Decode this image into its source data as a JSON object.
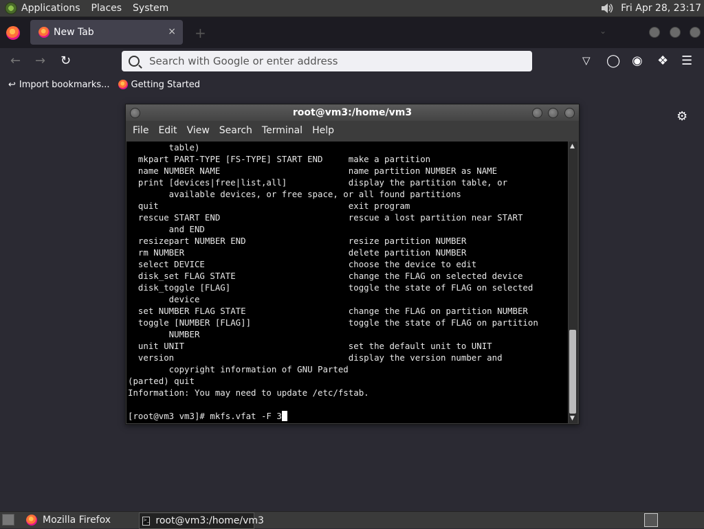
{
  "system_panel": {
    "menus": [
      "Applications",
      "Places",
      "System"
    ],
    "clock": "Fri Apr 28, 23:17"
  },
  "browser": {
    "tab": {
      "title": "New Tab",
      "close": "×"
    },
    "newtab_symbol": "+",
    "urlbar": {
      "placeholder": "Search with Google or enter address",
      "value": ""
    },
    "bookmarks": [
      {
        "label": "Import bookmarks...",
        "icon": "import-icon"
      },
      {
        "label": "Getting Started",
        "icon": "firefox-icon"
      }
    ]
  },
  "terminal": {
    "title": "root@vm3:/home/vm3",
    "menus": [
      "File",
      "Edit",
      "View",
      "Search",
      "Terminal",
      "Help"
    ],
    "lines": [
      "        table)",
      "  mkpart PART-TYPE [FS-TYPE] START END     make a partition",
      "  name NUMBER NAME                         name partition NUMBER as NAME",
      "  print [devices|free|list,all]            display the partition table, or",
      "        available devices, or free space, or all found partitions",
      "  quit                                     exit program",
      "  rescue START END                         rescue a lost partition near START",
      "        and END",
      "  resizepart NUMBER END                    resize partition NUMBER",
      "  rm NUMBER                                delete partition NUMBER",
      "  select DEVICE                            choose the device to edit",
      "  disk_set FLAG STATE                      change the FLAG on selected device",
      "  disk_toggle [FLAG]                       toggle the state of FLAG on selected",
      "        device",
      "  set NUMBER FLAG STATE                    change the FLAG on partition NUMBER",
      "  toggle [NUMBER [FLAG]]                   toggle the state of FLAG on partition",
      "        NUMBER",
      "  unit UNIT                                set the default unit to UNIT",
      "  version                                  display the version number and",
      "        copyright information of GNU Parted",
      "(parted) quit",
      "Information: You may need to update /etc/fstab.",
      "",
      "[root@vm3 vm3]# mkfs.vfat -F 3"
    ]
  },
  "taskbar": {
    "tasks": [
      {
        "label": "Mozilla Firefox",
        "icon": "firefox-icon"
      },
      {
        "label": "root@vm3:/home/vm3",
        "icon": "terminal-icon",
        "active": true
      }
    ]
  }
}
